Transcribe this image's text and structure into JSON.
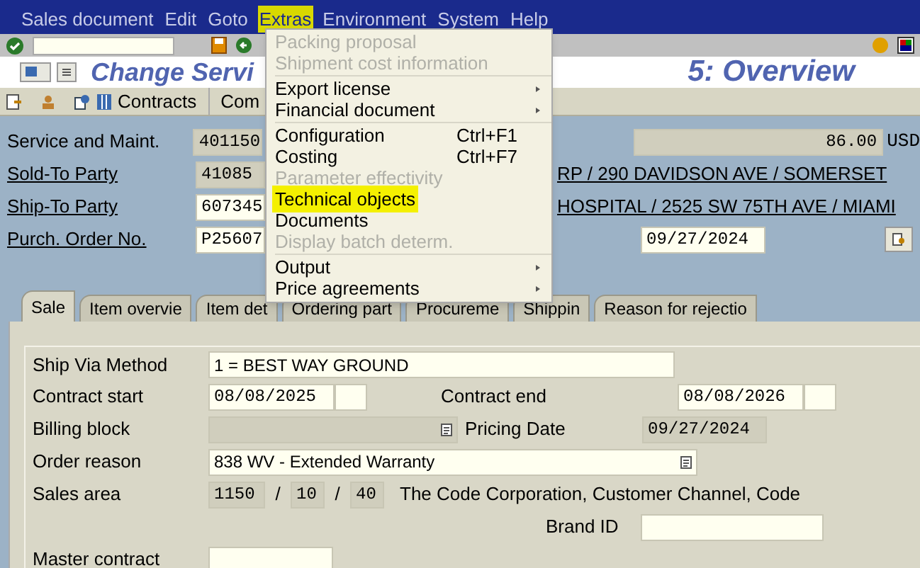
{
  "menubar": [
    {
      "label": "Sales document",
      "selected": false
    },
    {
      "label": "Edit",
      "selected": false
    },
    {
      "label": "Goto",
      "selected": false
    },
    {
      "label": "Extras",
      "selected": true
    },
    {
      "label": "Environment",
      "selected": false
    },
    {
      "label": "System",
      "selected": false
    },
    {
      "label": "Help",
      "selected": false
    }
  ],
  "title": {
    "left": "Change Servi",
    "right": "5: Overview"
  },
  "app_toolbar": {
    "contracts": "Contracts",
    "next": "Com"
  },
  "menu": [
    [
      {
        "label": "Packing proposal",
        "disabled": true,
        "selected": false,
        "submenu": false
      },
      {
        "label": "Shipment cost information",
        "disabled": true,
        "selected": false,
        "submenu": false
      }
    ],
    [
      {
        "label": "Export license",
        "disabled": false,
        "selected": false,
        "submenu": true
      },
      {
        "label": "Financial document",
        "disabled": false,
        "selected": false,
        "submenu": true
      }
    ],
    [
      {
        "label": "Configuration",
        "shortcut": "Ctrl+F1",
        "disabled": false,
        "selected": false,
        "submenu": false
      },
      {
        "label": "Costing",
        "shortcut": "Ctrl+F7",
        "disabled": false,
        "selected": false,
        "submenu": false
      },
      {
        "label": "Parameter effectivity",
        "disabled": true,
        "selected": false,
        "submenu": false
      },
      {
        "label": "Technical objects",
        "disabled": false,
        "selected": true,
        "submenu": false
      },
      {
        "label": "Documents",
        "disabled": false,
        "selected": false,
        "submenu": false
      },
      {
        "label": "Display batch determ.",
        "disabled": true,
        "selected": false,
        "submenu": false
      }
    ],
    [
      {
        "label": "Output",
        "disabled": false,
        "selected": false,
        "submenu": true
      },
      {
        "label": "Price agreements",
        "disabled": false,
        "selected": false,
        "submenu": true
      }
    ]
  ],
  "header": {
    "service_label": "Service and Maint.",
    "service_value": "401150",
    "net_value": "86.00",
    "currency": "USD",
    "sold_to_label": "Sold-To Party",
    "sold_to_value": "41085",
    "sold_to_address": "RP / 290 DAVIDSON AVE / SOMERSET",
    "ship_to_label": "Ship-To Party",
    "ship_to_value": "607345",
    "ship_to_address": "HOSPITAL / 2525 SW 75TH AVE / MIAMI",
    "po_label": "Purch. Order No.",
    "po_value": "P25607",
    "po_date": "09/27/2024"
  },
  "tabs": [
    {
      "label": "Sale",
      "selected": true
    },
    {
      "label": "Item overvie",
      "selected": false
    },
    {
      "label": "Item det",
      "selected": false
    },
    {
      "label": "Ordering part",
      "selected": false
    },
    {
      "label": "Procureme",
      "selected": false
    },
    {
      "label": "Shippin",
      "selected": false
    },
    {
      "label": "Reason for rejectio",
      "selected": false
    }
  ],
  "form": {
    "ship_via_label": "Ship Via Method",
    "ship_via_value": "1 = BEST WAY GROUND",
    "contract_start_label": "Contract start",
    "contract_start_value": "08/08/2025",
    "contract_end_label": "Contract end",
    "contract_end_value": "08/08/2026",
    "billing_block_label": "Billing block",
    "pricing_date_label": "Pricing Date",
    "pricing_date_value": "09/27/2024",
    "order_reason_label": "Order reason",
    "order_reason_value": "838 WV - Extended Warranty",
    "sales_area_label": "Sales area",
    "sales_org": "1150",
    "sep1": "/",
    "channel": "10",
    "sep2": "/",
    "division": "40",
    "sales_area_text": "The Code Corporation, Customer Channel, Code",
    "brand_label": "Brand ID",
    "master_contract_label": "Master contract"
  }
}
